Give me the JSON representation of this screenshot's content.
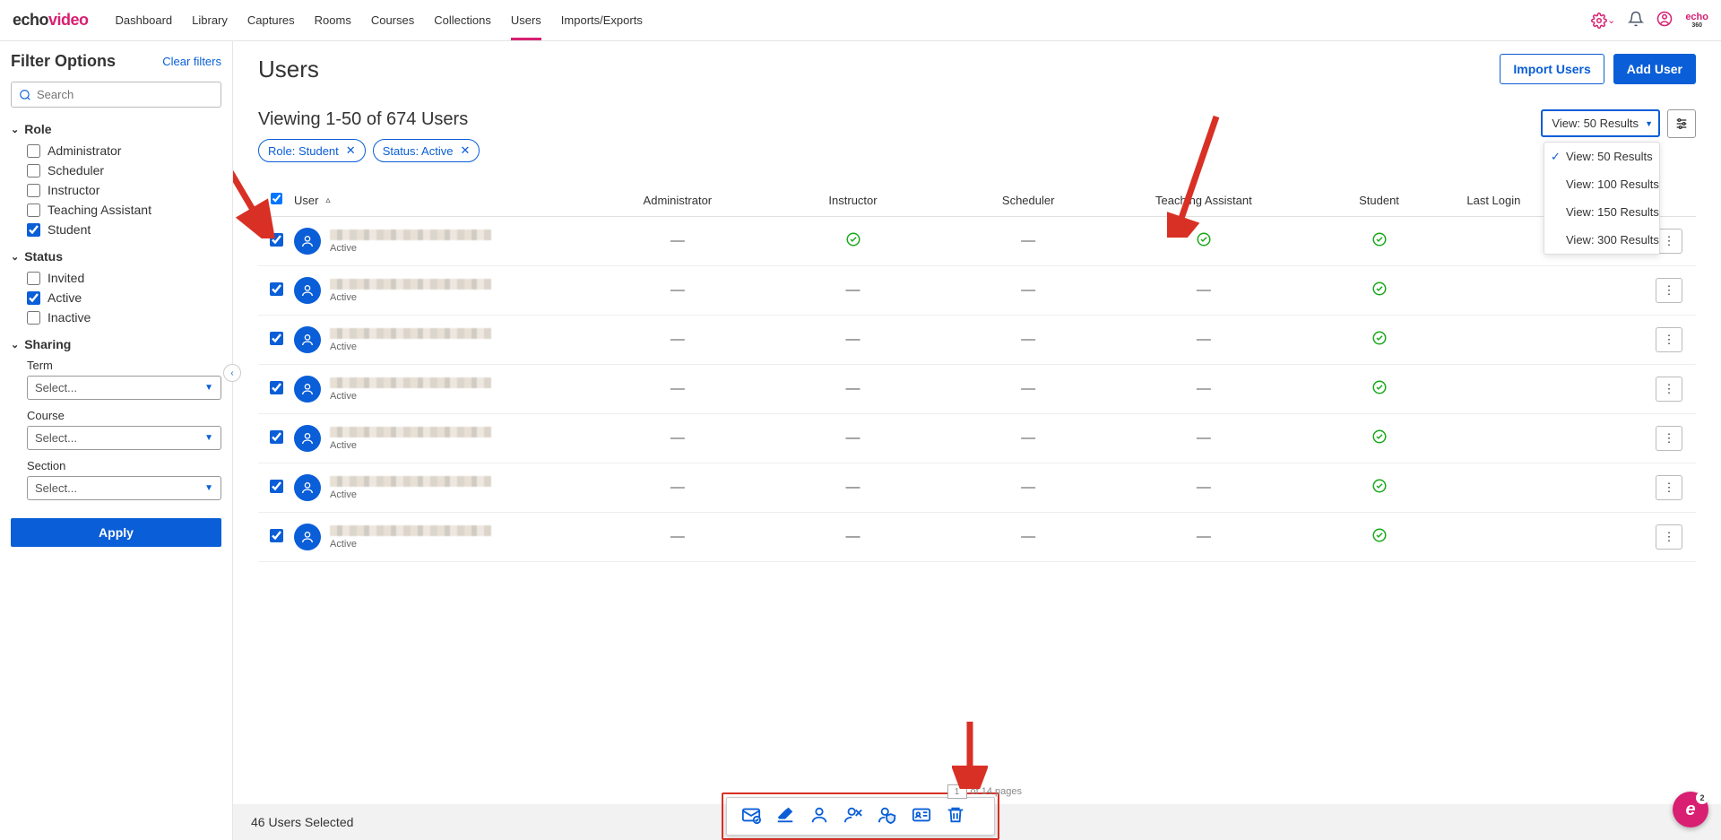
{
  "logo": {
    "part1": "echo",
    "part2": "video"
  },
  "nav": [
    "Dashboard",
    "Library",
    "Captures",
    "Rooms",
    "Courses",
    "Collections",
    "Users",
    "Imports/Exports"
  ],
  "nav_active_index": 6,
  "echo_badge": {
    "top": "echo",
    "bottom": "360"
  },
  "sidebar": {
    "title": "Filter Options",
    "clear": "Clear filters",
    "search_placeholder": "Search",
    "role_label": "Role",
    "roles": [
      {
        "label": "Administrator",
        "checked": false
      },
      {
        "label": "Scheduler",
        "checked": false
      },
      {
        "label": "Instructor",
        "checked": false
      },
      {
        "label": "Teaching Assistant",
        "checked": false
      },
      {
        "label": "Student",
        "checked": true
      }
    ],
    "status_label": "Status",
    "statuses": [
      {
        "label": "Invited",
        "checked": false
      },
      {
        "label": "Active",
        "checked": true
      },
      {
        "label": "Inactive",
        "checked": false
      }
    ],
    "sharing_label": "Sharing",
    "term_label": "Term",
    "course_label": "Course",
    "section_label": "Section",
    "select_placeholder": "Select...",
    "apply": "Apply"
  },
  "page": {
    "title": "Users",
    "import_btn": "Import Users",
    "add_btn": "Add User",
    "viewing": "Viewing 1-50 of 674 Users",
    "chips": [
      "Role: Student",
      "Status: Active"
    ],
    "view_selected": "View: 50 Results",
    "view_options": [
      "View: 50 Results",
      "View: 100 Results",
      "View: 150 Results",
      "View: 300 Results"
    ]
  },
  "table": {
    "headers": {
      "user": "User",
      "admin": "Administrator",
      "instructor": "Instructor",
      "scheduler": "Scheduler",
      "ta": "Teaching Assistant",
      "student": "Student",
      "last_login": "Last Login"
    },
    "status_text": "Active",
    "rows": [
      {
        "admin": "dash",
        "instructor": "check",
        "scheduler": "dash",
        "ta": "check",
        "student": "check"
      },
      {
        "admin": "dash",
        "instructor": "dash",
        "scheduler": "dash",
        "ta": "dash",
        "student": "check"
      },
      {
        "admin": "dash",
        "instructor": "dash",
        "scheduler": "dash",
        "ta": "dash",
        "student": "check"
      },
      {
        "admin": "dash",
        "instructor": "dash",
        "scheduler": "dash",
        "ta": "dash",
        "student": "check"
      },
      {
        "admin": "dash",
        "instructor": "dash",
        "scheduler": "dash",
        "ta": "dash",
        "student": "check"
      },
      {
        "admin": "dash",
        "instructor": "dash",
        "scheduler": "dash",
        "ta": "dash",
        "student": "check"
      },
      {
        "admin": "dash",
        "instructor": "dash",
        "scheduler": "dash",
        "ta": "dash",
        "student": "check"
      }
    ]
  },
  "footer": {
    "selected": "46 Users Selected"
  },
  "pagination": {
    "page": "1",
    "of": "of 14 pages"
  },
  "float_badge": {
    "letter": "e",
    "count": "2"
  }
}
